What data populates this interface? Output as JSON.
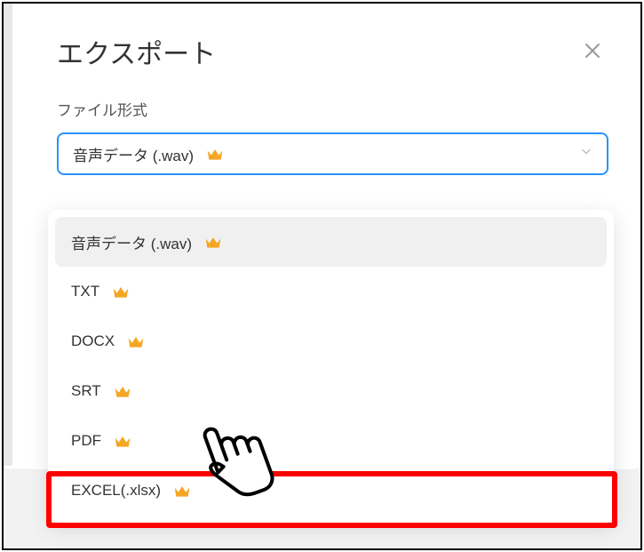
{
  "modal": {
    "title": "エクスポート",
    "close_aria": "閉じる",
    "file_format_label": "ファイル形式",
    "selected_value": "音声データ (.wav)"
  },
  "dropdown": {
    "items": [
      {
        "label": "音声データ (.wav)",
        "selected": true,
        "premium": true
      },
      {
        "label": "TXT",
        "selected": false,
        "premium": true
      },
      {
        "label": "DOCX",
        "selected": false,
        "premium": true
      },
      {
        "label": "SRT",
        "selected": false,
        "premium": true
      },
      {
        "label": "PDF",
        "selected": false,
        "premium": true
      },
      {
        "label": "EXCEL(.xlsx)",
        "selected": false,
        "premium": true
      }
    ]
  },
  "annotation": {
    "highlighted_index": 5,
    "cursor_type": "hand-pointer"
  },
  "colors": {
    "accent": "#2a91ff",
    "highlight": "#ff0000",
    "crown": "#f5a623"
  }
}
